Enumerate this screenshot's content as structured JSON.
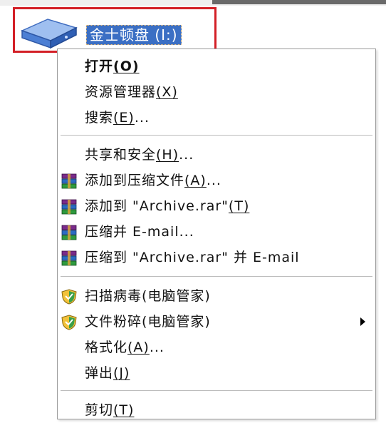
{
  "drive": {
    "name": "金士顿盘",
    "letter": "(I:)",
    "icon": "drive-icon"
  },
  "menu": {
    "items": [
      {
        "name": "open",
        "label": "打开",
        "accel": "(O)",
        "suffix": "",
        "icon": null
      },
      {
        "name": "explorer",
        "label": "资源管理器",
        "accel": "(X)",
        "suffix": "",
        "icon": null
      },
      {
        "name": "search",
        "label": "搜索",
        "accel": "(E)",
        "suffix": "...",
        "icon": null
      },
      {
        "name": "sharing-security",
        "label": "共享和安全",
        "accel": "(H)",
        "suffix": "...",
        "icon": null
      },
      {
        "name": "add-to-archive",
        "label": "添加到压缩文件",
        "accel": "(A)",
        "suffix": "...",
        "icon": "winrar-icon"
      },
      {
        "name": "add-to-archive-rar",
        "label": "添加到 \"Archive.rar\"",
        "accel": "(T)",
        "suffix": "",
        "icon": "winrar-icon"
      },
      {
        "name": "compress-email",
        "label": "压缩并 E-mail...",
        "accel": "",
        "suffix": "",
        "icon": "winrar-icon"
      },
      {
        "name": "compress-rar-email",
        "label": "压缩到 \"Archive.rar\" 并 E-mail",
        "accel": "",
        "suffix": "",
        "icon": "winrar-icon"
      },
      {
        "name": "scan-virus",
        "label": "扫描病毒(电脑管家)",
        "accel": "",
        "suffix": "",
        "icon": "shield-icon"
      },
      {
        "name": "file-shredder",
        "label": "文件粉碎(电脑管家)",
        "accel": "",
        "suffix": "",
        "icon": "shield-icon",
        "submenu": true
      },
      {
        "name": "format",
        "label": "格式化",
        "accel": "(A)",
        "suffix": "...",
        "icon": null
      },
      {
        "name": "eject",
        "label": "弹出",
        "accel": "(J)",
        "suffix": "",
        "icon": null
      },
      {
        "name": "cut",
        "label": "剪切",
        "accel": "(T)",
        "suffix": "",
        "icon": null
      }
    ]
  },
  "colors": {
    "selection": "#3b6fc4",
    "highlight_border": "#d31f26",
    "separator": "#bcbcbc"
  }
}
